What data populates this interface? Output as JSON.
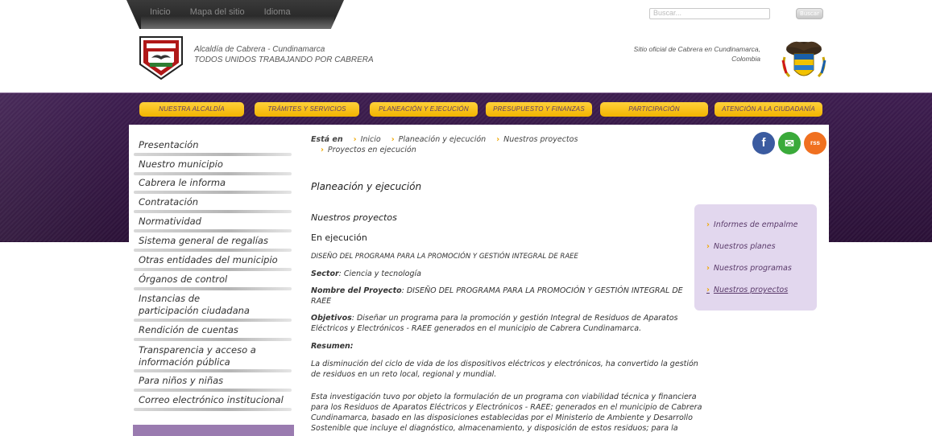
{
  "topbar": {
    "links": [
      "Inicio",
      "Mapa del sitio",
      "Idioma"
    ],
    "search_placeholder": "Buscar...",
    "search_button": "Buscar"
  },
  "header": {
    "title_line1": "Alcaldía de Cabrera - Cundinamarca",
    "title_line2": "TODOS UNIDOS TRABAJANDO POR CABRERA",
    "official_line1": "Sitio oficial de Cabrera en Cundinamarca,",
    "official_line2": "Colombia"
  },
  "nav": [
    "NUESTRA ALCALDÍA",
    "TRÁMITES Y SERVICIOS",
    "PLANEACIÓN Y EJECUCIÓN",
    "PRESUPUESTO Y FINANZAS",
    "PARTICIPACIÓN",
    "ATENCIÓN A LA CIUDADANÍA"
  ],
  "sidebar": [
    "Presentación",
    "Nuestro municipio",
    "Cabrera le informa",
    "Contratación",
    "Normatividad",
    "Sistema general de regalías",
    "Otras entidades del municipio",
    "Órganos de control",
    "Instancias de participación ciudadana",
    "Rendición de cuentas",
    "Transparencia y acceso a información pública",
    "Para niños y niñas",
    "Correo electrónico institucional"
  ],
  "breadcrumb": {
    "prefix": "Está en",
    "items": [
      "Inicio",
      "Planeación y ejecución",
      "Nuestros proyectos",
      "Proyectos en ejecución"
    ]
  },
  "social": {
    "facebook": "f",
    "email": "✉",
    "rss": "rss"
  },
  "main": {
    "heading": "Planeación y ejecución",
    "subheading": "Nuestros proyectos",
    "section": "En ejecución",
    "project_title": "DISEÑO DEL PROGRAMA PARA LA PROMOCIÓN Y GESTIÓN INTEGRAL DE RAEE",
    "sector_label": "Sector",
    "sector_value": ": Ciencia y tecnología",
    "name_label": "Nombre del Proyecto",
    "name_value": ": DISEÑO DEL PROGRAMA PARA LA PROMOCIÓN Y GESTIÓN INTEGRAL DE RAEE",
    "objectives_label": "Objetivos",
    "objectives_value": ": Diseñar un programa para la promoción y gestión Integral de Residuos de Aparatos Eléctricos y Electrónicos - RAEE generados en el municipio de Cabrera Cundinamarca.",
    "summary_label": "Resumen:",
    "paragraph1": "La disminución del ciclo de vida de los dispositivos eléctricos y electrónicos, ha convertido la gestión de residuos en un reto local, regional y mundial.",
    "paragraph2": "Esta investigación tuvo por objeto la formulación de un programa con viabilidad técnica y financiera para los Residuos de Aparatos Eléctricos y Electrónicos - RAEE; generados en el municipio de Cabrera Cundinamarca, basado en las disposiciones establecidas por el Ministerio de Ambiente y Desarrollo Sostenible que incluye el diagnóstico, almacenamiento, y disposición de estos residuos; para la"
  },
  "right_box": [
    {
      "label": "Informes de empalme",
      "active": false
    },
    {
      "label": "Nuestros planes",
      "active": false
    },
    {
      "label": "Nuestros programas",
      "active": false
    },
    {
      "label": "Nuestros proyectos",
      "active": true
    }
  ],
  "colors": {
    "band": "#2f1440",
    "nav_button": "#f7c21a",
    "right_box": "#e2d7ee",
    "accent_arrow": "#f0a800"
  }
}
